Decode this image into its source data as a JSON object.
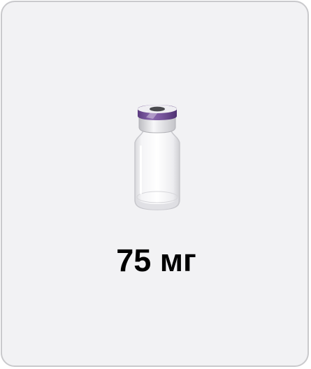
{
  "card": {
    "dose_label": "75 мг",
    "icon": "vial-icon",
    "colors": {
      "background": "#f2f2f4",
      "border": "#c9c9cc",
      "cap_band": "#6e4a93",
      "text": "#000000"
    }
  }
}
